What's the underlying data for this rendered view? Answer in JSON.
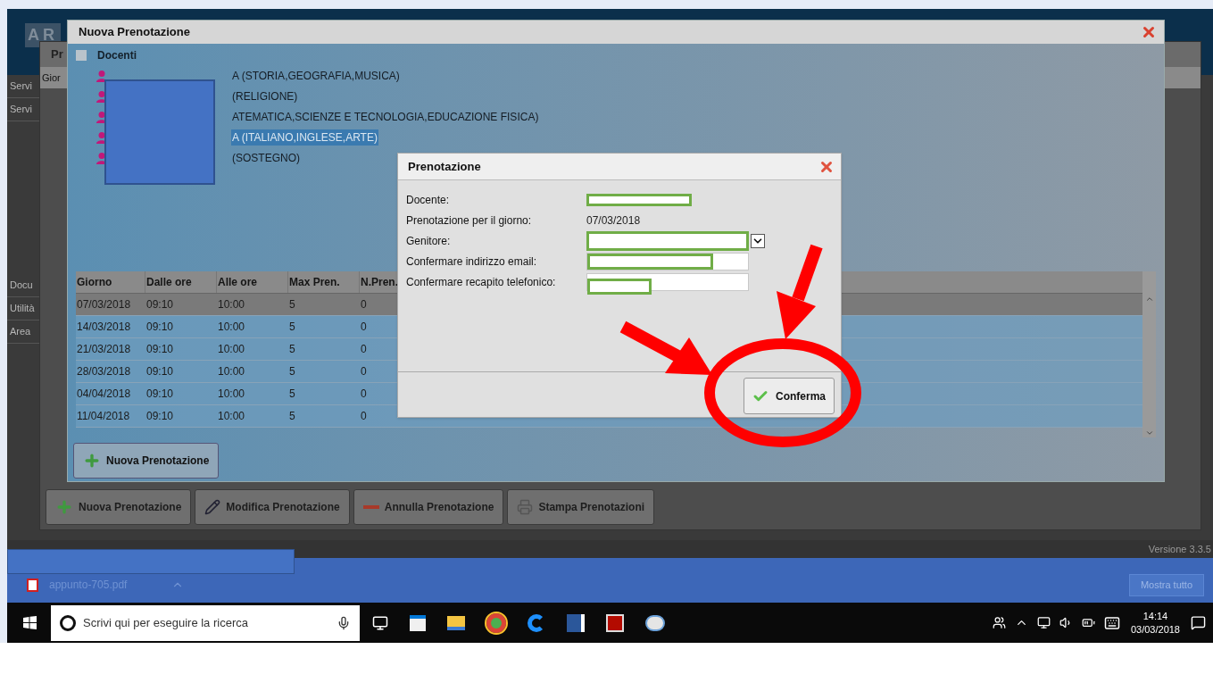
{
  "app": {
    "logo": "AR",
    "sidebar": [
      "Servi",
      "Servi",
      "Docu",
      "Utilità",
      "Area"
    ],
    "back_window": {
      "title": "Pr",
      "column": "Gior"
    },
    "toolbar": [
      {
        "kind": "add",
        "label": "Nuova Prenotazione",
        "disabled": false
      },
      {
        "kind": "edit",
        "label": "Modifica Prenotazione",
        "disabled": false
      },
      {
        "kind": "remove",
        "label": "Annulla Prenotazione",
        "disabled": false
      },
      {
        "kind": "print",
        "label": "Stampa Prenotazioni",
        "disabled": false
      }
    ],
    "version": "Versione 3.3.5"
  },
  "window": {
    "title": "Nuova Prenotazione",
    "tree": {
      "label": "Docenti",
      "checked": false,
      "children": [
        {
          "label": "A (STORIA,GEOGRAFIA,MUSICA)",
          "selected": false
        },
        {
          "label": "(RELIGIONE)",
          "selected": false
        },
        {
          "label": "ATEMATICA,SCIENZE E TECNOLOGIA,EDUCAZIONE FISICA)",
          "selected": false
        },
        {
          "label": "A (ITALIANO,INGLESE,ARTE)",
          "selected": true
        },
        {
          "label": "(SOSTEGNO)",
          "selected": false
        }
      ]
    },
    "table": {
      "columns": [
        "Giorno",
        "Dalle ore",
        "Alle ore",
        "Max Pren.",
        "N.Pren."
      ],
      "rows": [
        {
          "cells": [
            "07/03/2018",
            "09:10",
            "10:00",
            "5",
            "0"
          ],
          "selected": true
        },
        {
          "cells": [
            "14/03/2018",
            "09:10",
            "10:00",
            "5",
            "0"
          ],
          "selected": false
        },
        {
          "cells": [
            "21/03/2018",
            "09:10",
            "10:00",
            "5",
            "0"
          ],
          "selected": false
        },
        {
          "cells": [
            "28/03/2018",
            "09:10",
            "10:00",
            "5",
            "0"
          ],
          "selected": false
        },
        {
          "cells": [
            "04/04/2018",
            "09:10",
            "10:00",
            "5",
            "0"
          ],
          "selected": false
        },
        {
          "cells": [
            "11/04/2018",
            "09:10",
            "10:00",
            "5",
            "0"
          ],
          "selected": false
        }
      ]
    },
    "add_button": "Nuova Prenotazione"
  },
  "dialog": {
    "title": "Prenotazione",
    "fields": [
      {
        "label": "Docente:",
        "kind": "redacted"
      },
      {
        "label": "Prenotazione per il giorno:",
        "kind": "text",
        "value": "07/03/2018"
      },
      {
        "label": "Genitore:",
        "kind": "select"
      },
      {
        "label": "Confermare indirizzo email:",
        "kind": "input"
      },
      {
        "label": "Confermare recapito telefonico:",
        "kind": "input"
      }
    ],
    "confirm": "Conferma"
  },
  "download_bar": {
    "file": "appunto-705.pdf",
    "show_all": "Mostra tutto"
  },
  "taskbar": {
    "search_placeholder": "Scrivi qui per eseguire la ricerca",
    "time": "14:14",
    "date": "03/03/2018"
  }
}
